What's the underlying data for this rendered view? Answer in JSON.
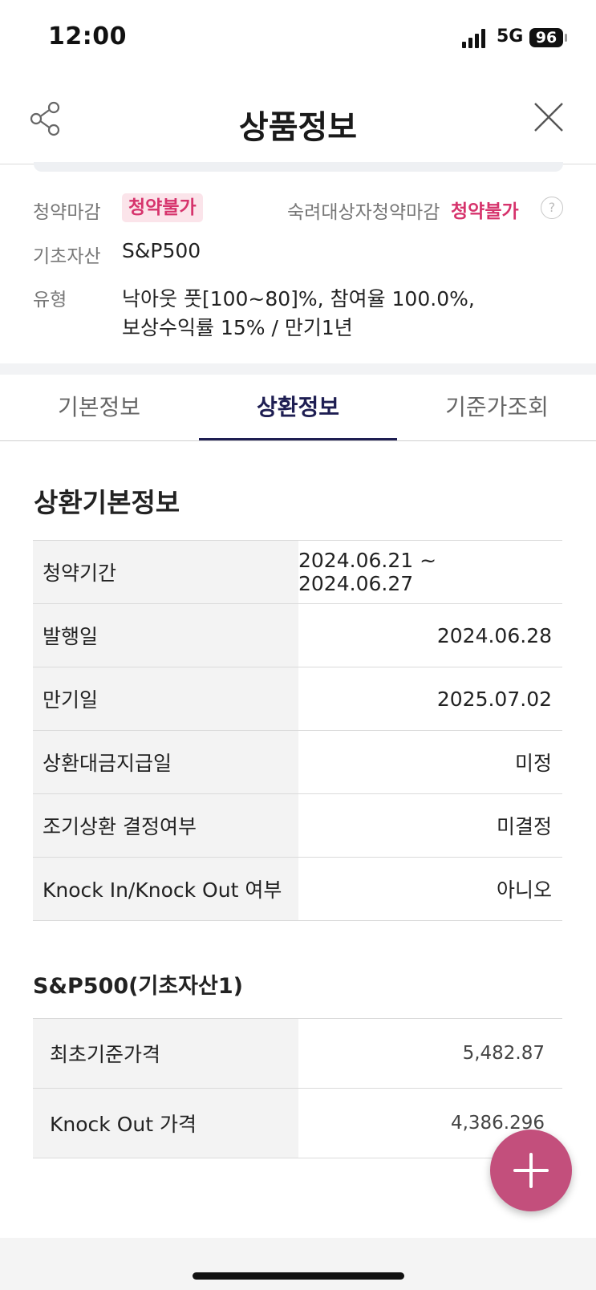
{
  "status_bar": {
    "time": "12:00",
    "network": "5G",
    "battery": "96"
  },
  "header": {
    "title": "상품정보"
  },
  "product": {
    "subscription_deadline_label": "청약마감",
    "subscription_deadline_value": "청약불가",
    "elderly_deadline_label": "숙려대상자청약마감",
    "elderly_deadline_value": "청약불가",
    "help": "?",
    "underlying_label": "기초자산",
    "underlying_value": "S&P500",
    "type_label": "유형",
    "type_value_line1": "낙아웃 풋[100~80]%, 참여율 100.0%,",
    "type_value_line2": "보상수익률 15% / 만기1년"
  },
  "tabs": [
    {
      "label": "기본정보"
    },
    {
      "label": "상환정보"
    },
    {
      "label": "기준가조회"
    }
  ],
  "repayment": {
    "title": "상환기본정보",
    "rows": [
      {
        "key": "청약기간",
        "value": "2024.06.21 ~ 2024.06.27"
      },
      {
        "key": "발행일",
        "value": "2024.06.28"
      },
      {
        "key": "만기일",
        "value": "2025.07.02"
      },
      {
        "key": "상환대금지급일",
        "value": "미정"
      },
      {
        "key": "조기상환 결정여부",
        "value": "미결정"
      },
      {
        "key": "Knock In/Knock Out 여부",
        "value": "아니오"
      }
    ]
  },
  "underlying_asset": {
    "title": "S&P500(기초자산1)",
    "rows": [
      {
        "key": "최초기준가격",
        "value": "5,482.87"
      },
      {
        "key": "Knock Out 가격",
        "value": "4,386.296"
      }
    ]
  },
  "colors": {
    "accent": "#1e1e52",
    "badge": "#d6336c",
    "fab": "#c34f7c"
  }
}
